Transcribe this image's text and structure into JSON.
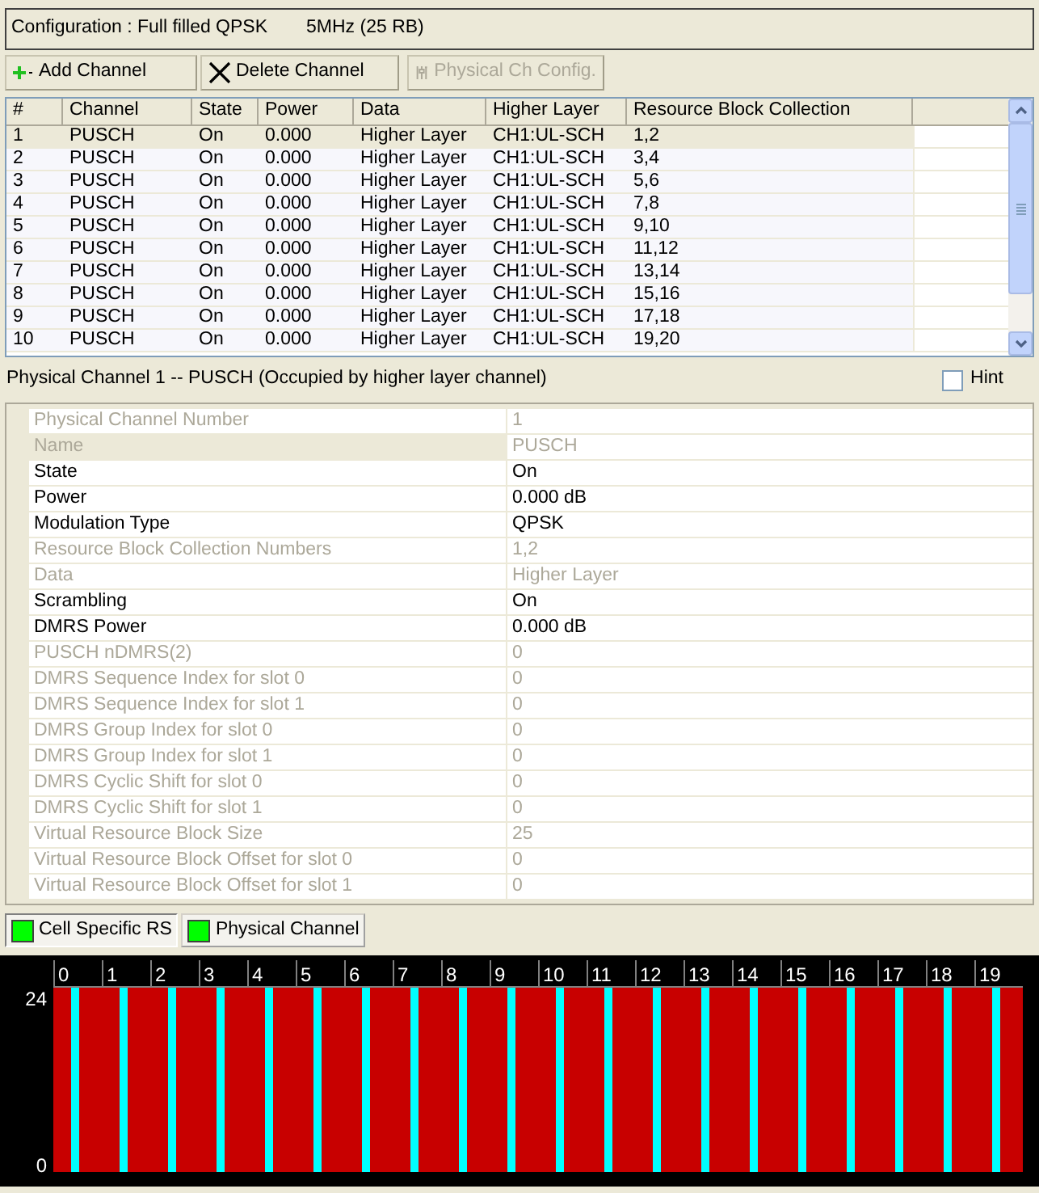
{
  "configuration": {
    "label": "Configuration : Full filled QPSK",
    "bandwidth": "5MHz (25 RB)"
  },
  "toolbar": [
    {
      "kind": "add",
      "label": "Add Channel",
      "disabled": false
    },
    {
      "kind": "delete",
      "label": "Delete Channel",
      "disabled": false
    },
    {
      "kind": "config",
      "label": "Physical Ch Config.",
      "disabled": true
    }
  ],
  "table": {
    "columns": [
      "#",
      "Channel",
      "State",
      "Power",
      "Data",
      "Higher Layer",
      "Resource Block Collection"
    ],
    "rows": [
      {
        "cells": [
          "1",
          "PUSCH",
          "On",
          "0.000",
          "Higher Layer",
          "CH1:UL-SCH",
          "1,2"
        ],
        "selected": true
      },
      {
        "cells": [
          "2",
          "PUSCH",
          "On",
          "0.000",
          "Higher Layer",
          "CH1:UL-SCH",
          "3,4"
        ],
        "selected": false
      },
      {
        "cells": [
          "3",
          "PUSCH",
          "On",
          "0.000",
          "Higher Layer",
          "CH1:UL-SCH",
          "5,6"
        ],
        "selected": false
      },
      {
        "cells": [
          "4",
          "PUSCH",
          "On",
          "0.000",
          "Higher Layer",
          "CH1:UL-SCH",
          "7,8"
        ],
        "selected": false
      },
      {
        "cells": [
          "5",
          "PUSCH",
          "On",
          "0.000",
          "Higher Layer",
          "CH1:UL-SCH",
          "9,10"
        ],
        "selected": false
      },
      {
        "cells": [
          "6",
          "PUSCH",
          "On",
          "0.000",
          "Higher Layer",
          "CH1:UL-SCH",
          "11,12"
        ],
        "selected": false
      },
      {
        "cells": [
          "7",
          "PUSCH",
          "On",
          "0.000",
          "Higher Layer",
          "CH1:UL-SCH",
          "13,14"
        ],
        "selected": false
      },
      {
        "cells": [
          "8",
          "PUSCH",
          "On",
          "0.000",
          "Higher Layer",
          "CH1:UL-SCH",
          "15,16"
        ],
        "selected": false
      },
      {
        "cells": [
          "9",
          "PUSCH",
          "On",
          "0.000",
          "Higher Layer",
          "CH1:UL-SCH",
          "17,18"
        ],
        "selected": false
      },
      {
        "cells": [
          "10",
          "PUSCH",
          "On",
          "0.000",
          "Higher Layer",
          "CH1:UL-SCH",
          "19,20"
        ],
        "selected": false
      }
    ]
  },
  "section": {
    "title": "Physical Channel 1 -- PUSCH (Occupied by higher layer channel)",
    "hint": {
      "label": "Hint",
      "checked": false
    }
  },
  "properties": [
    {
      "name": "Physical Channel Number",
      "value": "1",
      "disabled": true,
      "selected": false
    },
    {
      "name": "Name",
      "value": "PUSCH",
      "disabled": true,
      "selected": true
    },
    {
      "name": "State",
      "value": "On",
      "disabled": false,
      "selected": false
    },
    {
      "name": "Power",
      "value": "0.000 dB",
      "disabled": false,
      "selected": false
    },
    {
      "name": "Modulation Type",
      "value": "QPSK",
      "disabled": false,
      "selected": false
    },
    {
      "name": "Resource Block Collection Numbers",
      "value": "1,2",
      "disabled": true,
      "selected": false
    },
    {
      "name": "Data",
      "value": "Higher Layer",
      "disabled": true,
      "selected": false
    },
    {
      "name": "Scrambling",
      "value": "On",
      "disabled": false,
      "selected": false
    },
    {
      "name": "DMRS Power",
      "value": "0.000 dB",
      "disabled": false,
      "selected": false
    },
    {
      "name": "PUSCH nDMRS(2)",
      "value": "0",
      "disabled": true,
      "selected": false
    },
    {
      "name": "DMRS Sequence Index for slot 0",
      "value": "0",
      "disabled": true,
      "selected": false
    },
    {
      "name": "DMRS Sequence Index for slot 1",
      "value": "0",
      "disabled": true,
      "selected": false
    },
    {
      "name": "DMRS Group Index for slot 0",
      "value": "0",
      "disabled": true,
      "selected": false
    },
    {
      "name": "DMRS Group Index for slot 1",
      "value": "0",
      "disabled": true,
      "selected": false
    },
    {
      "name": "DMRS Cyclic Shift for slot 0",
      "value": "0",
      "disabled": true,
      "selected": false
    },
    {
      "name": "DMRS Cyclic Shift for slot 1",
      "value": "0",
      "disabled": true,
      "selected": false
    },
    {
      "name": "Virtual Resource Block Size",
      "value": "25",
      "disabled": true,
      "selected": false
    },
    {
      "name": "Virtual Resource Block Offset for slot 0",
      "value": "0",
      "disabled": true,
      "selected": false
    },
    {
      "name": "Virtual Resource Block Offset for slot 1",
      "value": "0",
      "disabled": true,
      "selected": false
    }
  ],
  "legend": [
    {
      "label": "Cell Specific RS",
      "selected": true
    },
    {
      "label": "Physical Channel",
      "selected": false
    }
  ],
  "resource_map": {
    "slot_labels": [
      "0",
      "1",
      "2",
      "3",
      "4",
      "5",
      "6",
      "7",
      "8",
      "9",
      "10",
      "11",
      "12",
      "13",
      "14",
      "15",
      "16",
      "17",
      "18",
      "19"
    ],
    "rb_labels": [
      "24",
      "0"
    ]
  }
}
